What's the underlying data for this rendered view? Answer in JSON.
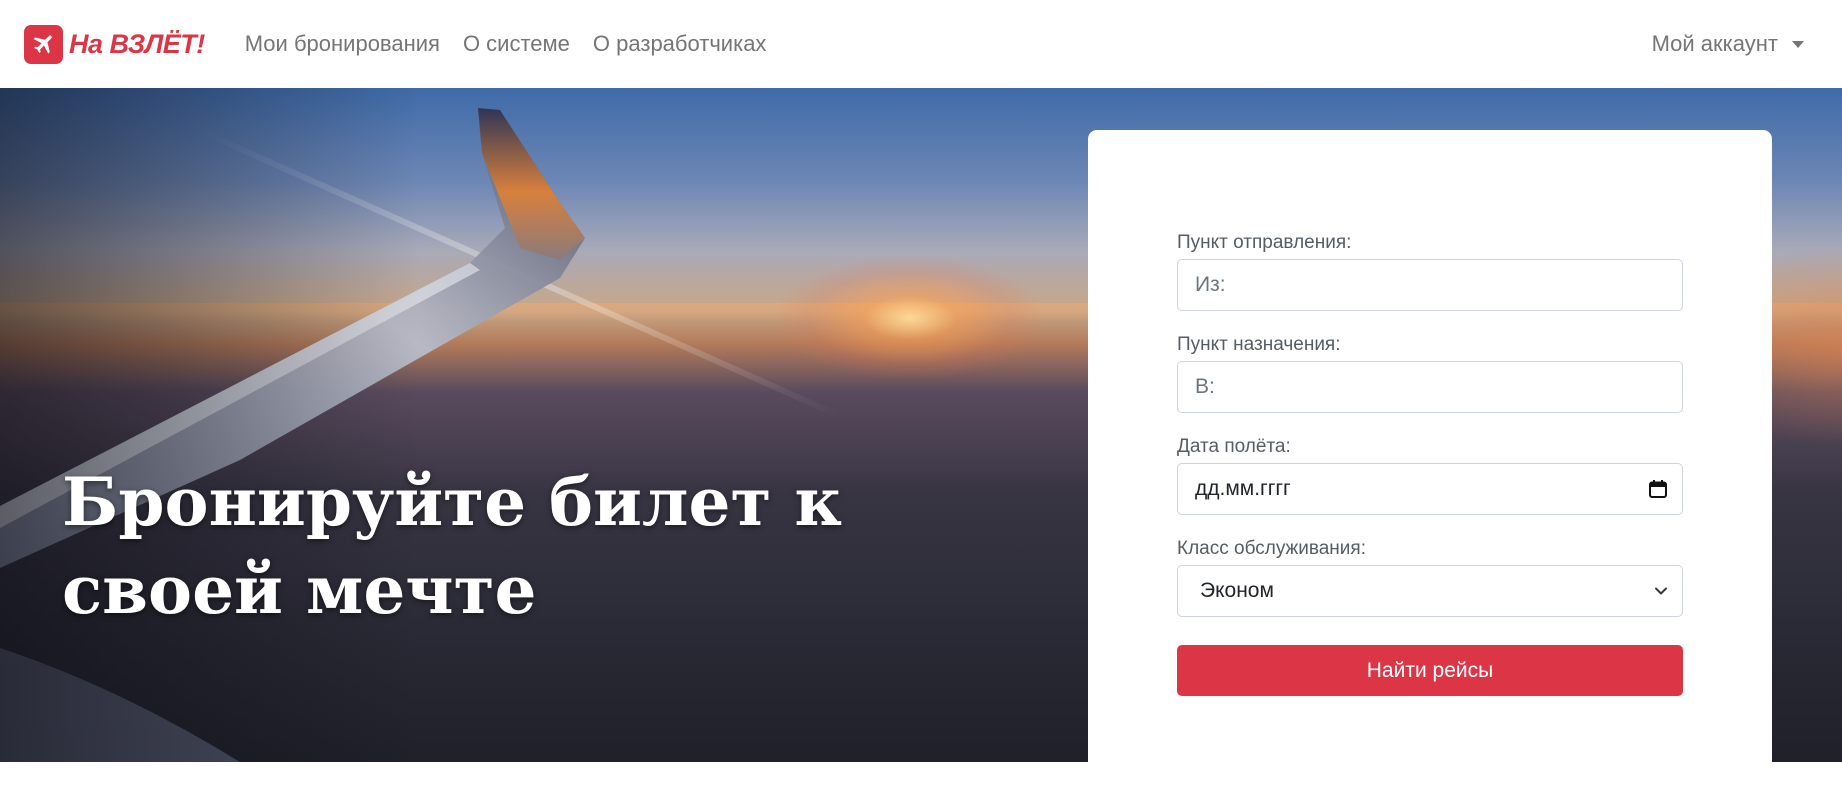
{
  "brand": {
    "name": "На ВЗЛЁТ!",
    "icon": "airplane-icon",
    "color": "#dc3545"
  },
  "nav": {
    "links": [
      "Мои бронирования",
      "О системе",
      "О разработчиках"
    ],
    "account": "Мой аккаунт"
  },
  "hero": {
    "title": "Бронируйте билет к своей мечте"
  },
  "search_form": {
    "origin": {
      "label": "Пункт отправления:",
      "placeholder": "Из:"
    },
    "destination": {
      "label": "Пункт назначения:",
      "placeholder": "В:"
    },
    "date": {
      "label": "Дата полёта:",
      "placeholder": "дд.мм.гггг",
      "icon": "calendar-icon"
    },
    "class": {
      "label": "Класс обслуживания:",
      "selected": "Эконом",
      "icon": "chevron-down-icon"
    },
    "submit_label": "Найти рейсы"
  }
}
